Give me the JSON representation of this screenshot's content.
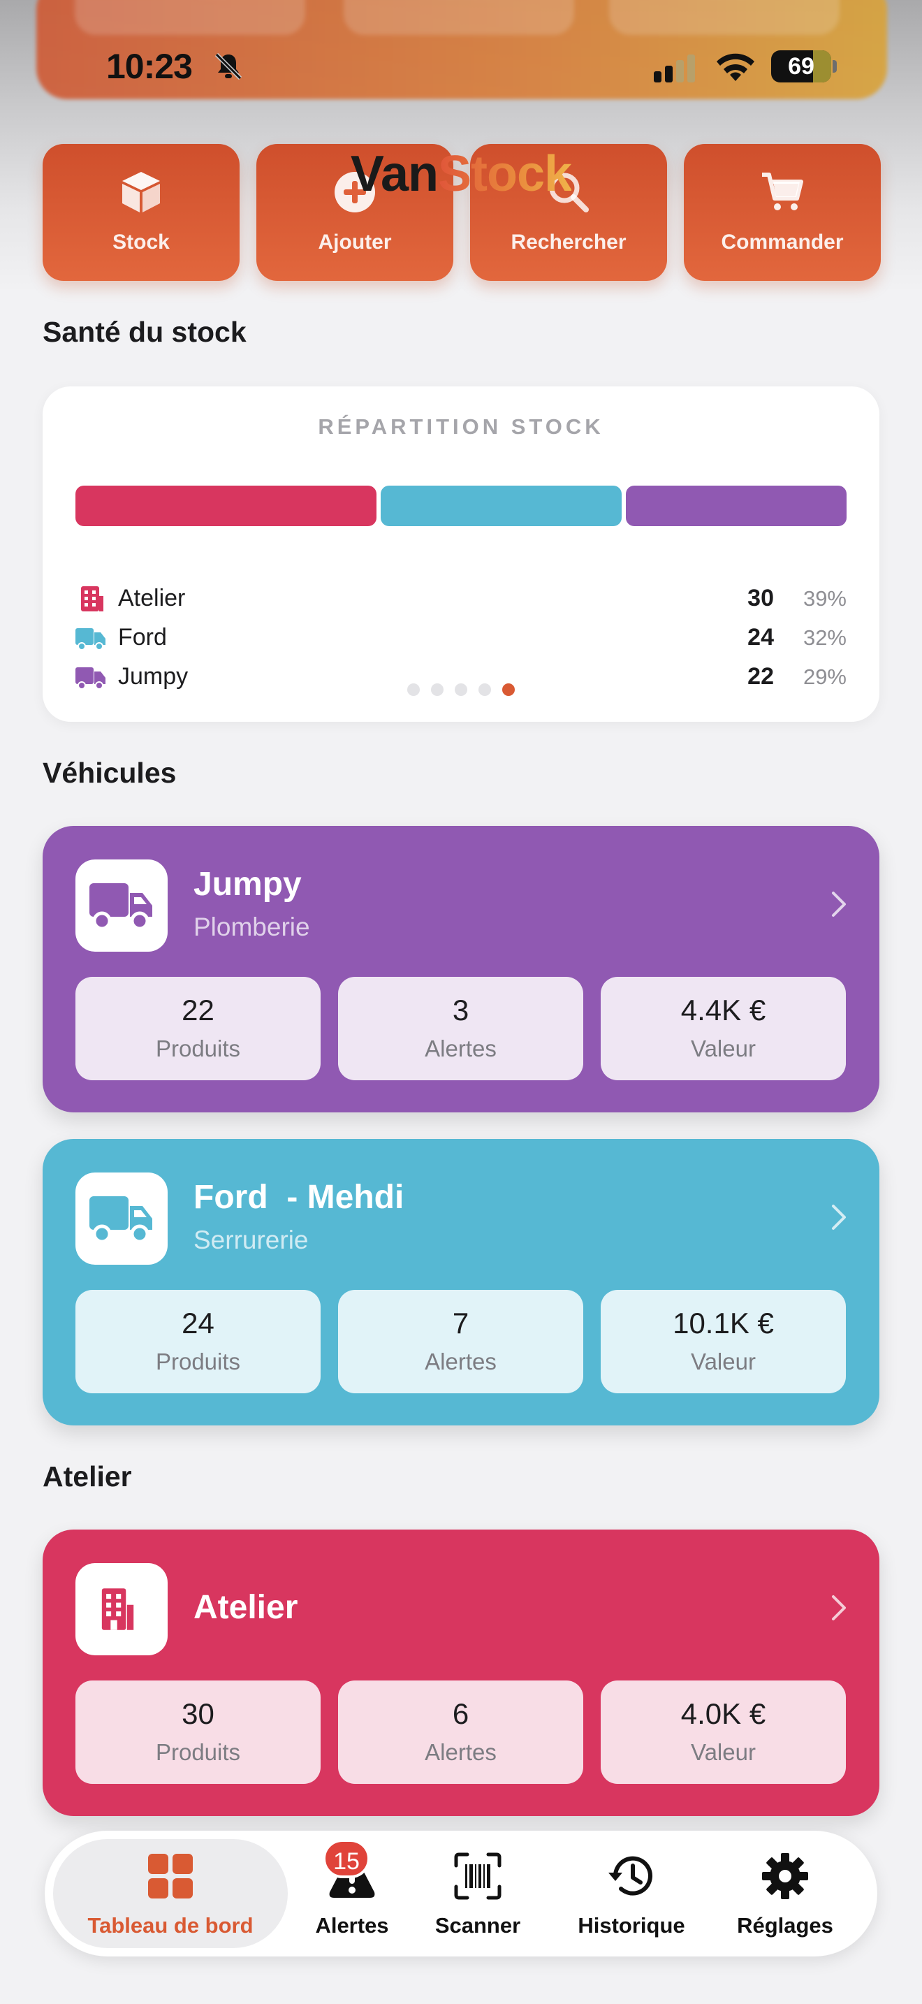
{
  "status_bar": {
    "time": "10:23",
    "battery": "69"
  },
  "header_behind": {
    "items": [
      "Produits",
      "Alertes",
      "Valeur"
    ]
  },
  "app": {
    "title_part1": "Van",
    "title_part2": "Stock"
  },
  "quick_actions": [
    {
      "label": "Stock",
      "icon": "cube-icon"
    },
    {
      "label": "Ajouter",
      "icon": "plus-circle-icon"
    },
    {
      "label": "Rechercher",
      "icon": "magnifier-icon"
    },
    {
      "label": "Commander",
      "icon": "cart-icon"
    }
  ],
  "health": {
    "section_title": "Santé du stock",
    "card_title": "RÉPARTITION STOCK",
    "rows": [
      {
        "name": "Atelier",
        "count": "30",
        "pct": "39%",
        "color": "#d8365f",
        "icon": "building-icon"
      },
      {
        "name": "Ford",
        "count": "24",
        "pct": "32%",
        "color": "#56b8d3",
        "icon": "truck-icon"
      },
      {
        "name": "Jumpy",
        "count": "22",
        "pct": "29%",
        "color": "#9059b2",
        "icon": "truck-icon"
      }
    ],
    "pages": 5,
    "active_page": 5
  },
  "vehicles": {
    "section_title": "Véhicules",
    "items": [
      {
        "name": "Jumpy",
        "subtitle": "Plomberie",
        "color": "#9059b2",
        "stats": [
          {
            "value": "22",
            "label": "Produits"
          },
          {
            "value": "3",
            "label": "Alertes"
          },
          {
            "value": "4.4K €",
            "label": "Valeur"
          }
        ]
      },
      {
        "name": "Ford  - Mehdi",
        "subtitle": "Serrurerie",
        "color": "#56b8d3",
        "stats": [
          {
            "value": "24",
            "label": "Produits"
          },
          {
            "value": "7",
            "label": "Alertes"
          },
          {
            "value": "10.1K €",
            "label": "Valeur"
          }
        ]
      }
    ]
  },
  "atelier": {
    "section_title": "Atelier",
    "name": "Atelier",
    "color": "#d8365f",
    "stats": [
      {
        "value": "30",
        "label": "Produits"
      },
      {
        "value": "6",
        "label": "Alertes"
      },
      {
        "value": "4.0K €",
        "label": "Valeur"
      }
    ]
  },
  "tabbar": {
    "items": [
      {
        "label": "Tableau de bord",
        "icon": "grid-icon",
        "active": true
      },
      {
        "label": "Alertes",
        "icon": "warning-icon",
        "badge": "15"
      },
      {
        "label": "Scanner",
        "icon": "barcode-scan-icon"
      },
      {
        "label": "Historique",
        "icon": "history-icon"
      },
      {
        "label": "Réglages",
        "icon": "gear-icon"
      }
    ]
  },
  "colors": {
    "accent": "#d95a33",
    "background": "#f2f2f4"
  }
}
